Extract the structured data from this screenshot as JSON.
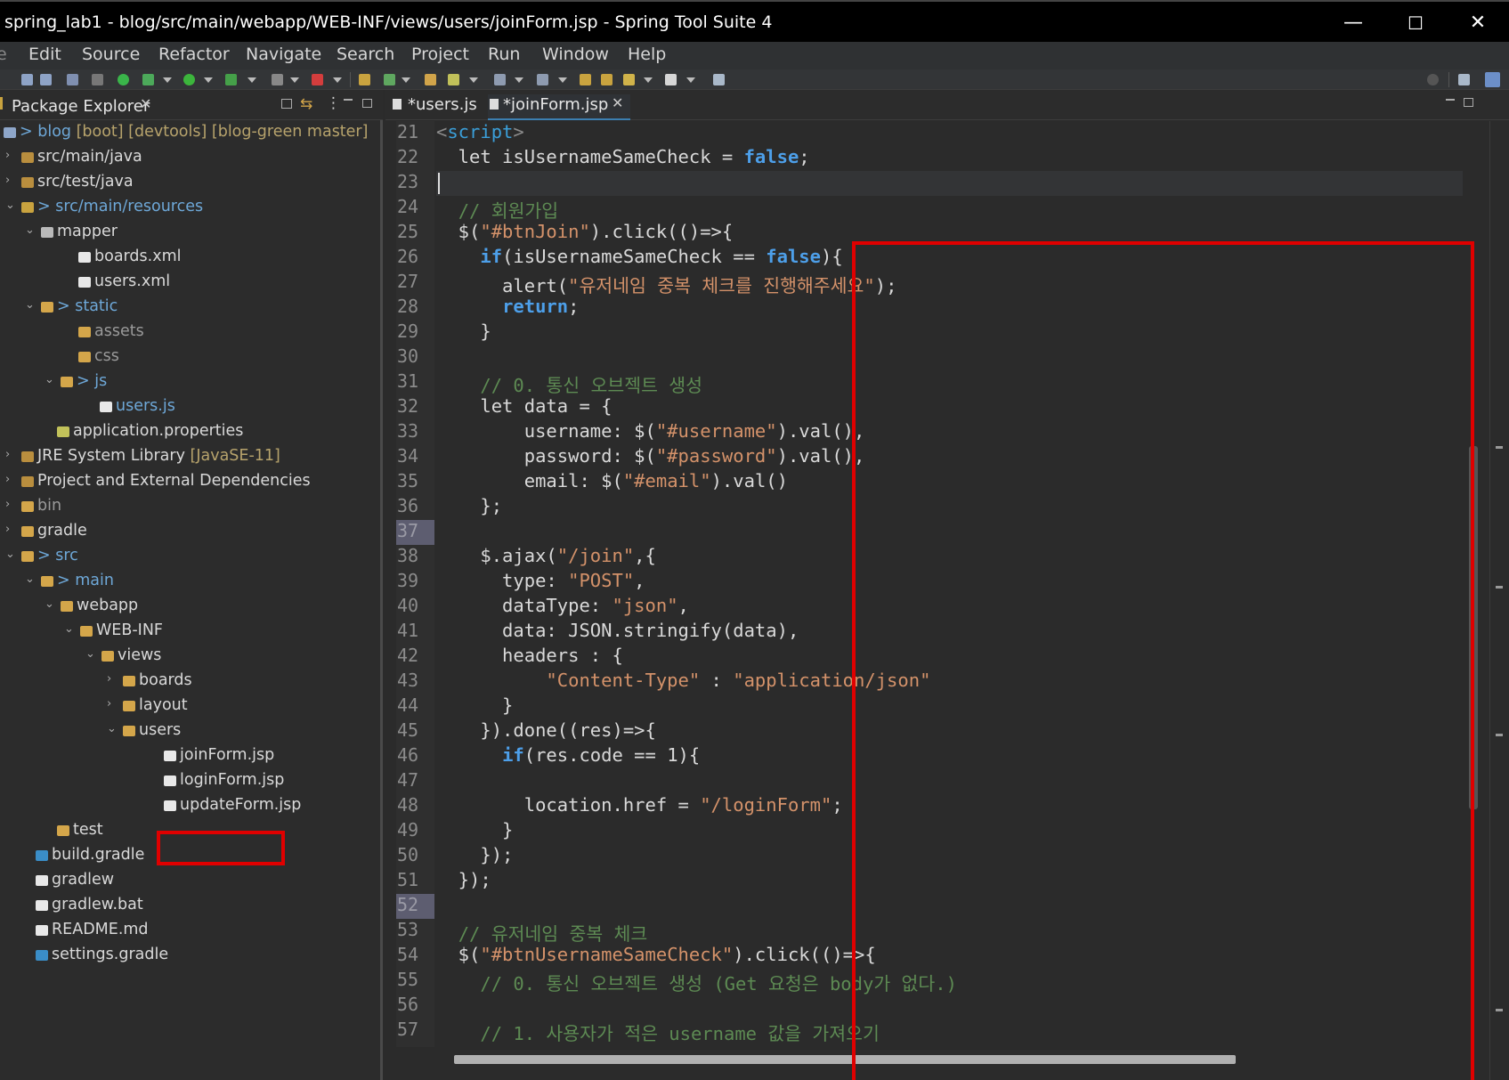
{
  "window": {
    "title": "spring_lab1 - blog/src/main/webapp/WEB-INF/views/users/joinForm.jsp - Spring Tool Suite 4",
    "minimize": "—",
    "maximize": "☐",
    "close": "✕"
  },
  "menu": [
    "Edit",
    "Source",
    "Refactor",
    "Navigate",
    "Search",
    "Project",
    "Run",
    "Window",
    "Help"
  ],
  "explorer": {
    "title": "Package Explorer",
    "close": "✕",
    "tree": [
      {
        "label": "> blog",
        "dec": " [boot] [devtools] [blog-green master]",
        "arrow": "⌄"
      },
      {
        "label": "src/main/java",
        "arrow": "›"
      },
      {
        "label": "src/test/java",
        "arrow": "›"
      },
      {
        "label": "> src/main/resources",
        "arrow": "⌄"
      },
      {
        "label": "mapper",
        "arrow": "⌄"
      },
      {
        "label": "boards.xml"
      },
      {
        "label": "users.xml"
      },
      {
        "label": "> static",
        "arrow": "⌄"
      },
      {
        "label": "assets"
      },
      {
        "label": "css"
      },
      {
        "label": "> js",
        "arrow": "⌄"
      },
      {
        "label": "users.js"
      },
      {
        "label": "application.properties"
      },
      {
        "label": "JRE System Library",
        "dec": " [JavaSE-11]",
        "arrow": "›"
      },
      {
        "label": "Project and External Dependencies",
        "arrow": "›"
      },
      {
        "label": "bin",
        "arrow": "›"
      },
      {
        "label": "gradle",
        "arrow": "›"
      },
      {
        "label": "> src",
        "arrow": "⌄"
      },
      {
        "label": "> main",
        "arrow": "⌄"
      },
      {
        "label": "webapp",
        "arrow": "⌄"
      },
      {
        "label": "WEB-INF",
        "arrow": "⌄"
      },
      {
        "label": "views",
        "arrow": "⌄"
      },
      {
        "label": "boards",
        "arrow": "›"
      },
      {
        "label": "layout",
        "arrow": "›"
      },
      {
        "label": "users",
        "arrow": "⌄"
      },
      {
        "label": "joinForm.jsp"
      },
      {
        "label": "loginForm.jsp"
      },
      {
        "label": "updateForm.jsp"
      },
      {
        "label": "test"
      },
      {
        "label": "build.gradle"
      },
      {
        "label": "gradlew"
      },
      {
        "label": "gradlew.bat"
      },
      {
        "label": "README.md"
      },
      {
        "label": "settings.gradle"
      }
    ]
  },
  "editor": {
    "tabs": [
      {
        "label": "*users.js",
        "close": ""
      },
      {
        "label": "*joinForm.jsp",
        "close": "✕"
      }
    ],
    "line_numbers": [
      "21",
      "22",
      "23",
      "24",
      "25",
      "26",
      "27",
      "28",
      "29",
      "30",
      "31",
      "32",
      "33",
      "34",
      "35",
      "36",
      "37",
      "38",
      "39",
      "40",
      "41",
      "42",
      "43",
      "44",
      "45",
      "46",
      "47",
      "48",
      "49",
      "50",
      "51",
      "52",
      "53",
      "54",
      "55",
      "56",
      "57"
    ],
    "lines": [
      [
        "<",
        "script",
        ">"
      ],
      [
        "  let isUsernameSameCheck = ",
        "false",
        ";"
      ],
      [
        ""
      ],
      [
        "  ",
        "// 회원가입"
      ],
      [
        "  $(",
        "\"#btnJoin\"",
        ").click(()=>{"
      ],
      [
        "    ",
        "if",
        "(isUsernameSameCheck == ",
        "false",
        "){"
      ],
      [
        "      alert(",
        "\"유저네임 중복 체크를 진행해주세요\"",
        ");"
      ],
      [
        "      ",
        "return",
        ";"
      ],
      [
        "    }"
      ],
      [
        ""
      ],
      [
        "    ",
        "// 0. 통신 오브젝트 생성"
      ],
      [
        "    let data = {"
      ],
      [
        "        username: $(",
        "\"#username\"",
        ").val(),"
      ],
      [
        "        password: $(",
        "\"#password\"",
        ").val(),"
      ],
      [
        "        email: $(",
        "\"#email\"",
        ").val()"
      ],
      [
        "    };"
      ],
      [
        ""
      ],
      [
        "    $.ajax(",
        "\"/join\"",
        ",{"
      ],
      [
        "      type: ",
        "\"POST\"",
        ","
      ],
      [
        "      dataType: ",
        "\"json\"",
        ","
      ],
      [
        "      data: JSON.stringify(data),"
      ],
      [
        "      headers : {"
      ],
      [
        "          ",
        "\"Content-Type\"",
        " : ",
        "\"application/json\""
      ],
      [
        "      }"
      ],
      [
        "    }).done((res)=>{"
      ],
      [
        "      ",
        "if",
        "(res.code == 1){"
      ],
      [
        ""
      ],
      [
        "        location.href = ",
        "\"/loginForm\"",
        ";"
      ],
      [
        "      }"
      ],
      [
        "    });"
      ],
      [
        "  });"
      ],
      [
        ""
      ],
      [
        "  ",
        "// 유저네임 중복 체크"
      ],
      [
        "  $(",
        "\"#btnUsernameSameCheck\"",
        ").click(()=>{"
      ],
      [
        "    ",
        "// 0. 통신 오브젝트 생성 (Get 요청은 body가 없다.)"
      ],
      [
        ""
      ],
      [
        "    ",
        "// 1. 사용자가 적은 username 값을 가져오기"
      ]
    ]
  },
  "colors": {
    "keyword": "#4d9fe9",
    "string": "#d4926a",
    "comment": "#5d8a53",
    "highlight": "#e00000"
  }
}
